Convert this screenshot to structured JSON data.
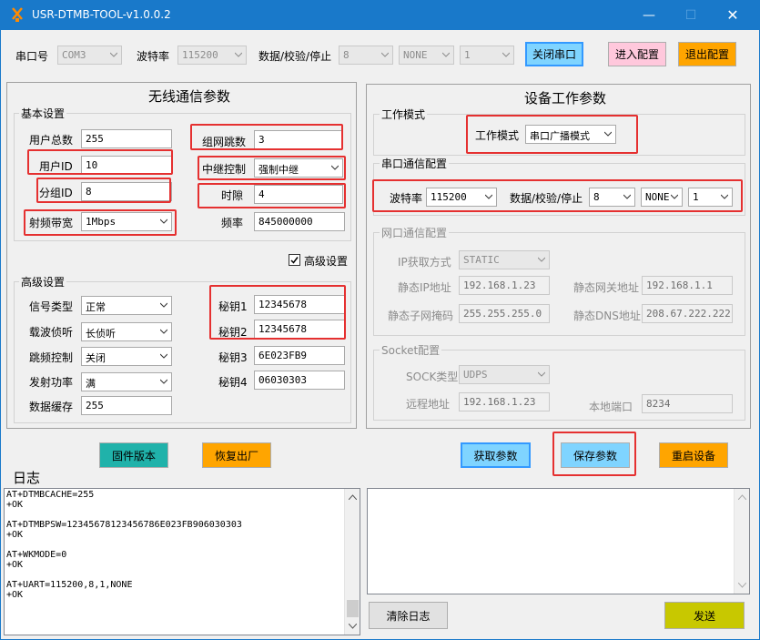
{
  "window": {
    "title": "USR-DTMB-TOOL-v1.0.0.2",
    "minimize_icon": "minimize-icon",
    "maximize_icon": "maximize-icon",
    "close_icon": "close-icon"
  },
  "top": {
    "port_label": "串口号",
    "port_value": "COM3",
    "baud_label": "波特率",
    "baud_value": "115200",
    "dps_label": "数据/校验/停止",
    "data_bits": "8",
    "parity": "NONE",
    "stop_bits": "1",
    "close_port_btn": "关闭串口",
    "enter_config_btn": "进入配置",
    "exit_config_btn": "退出配置"
  },
  "wireless": {
    "title": "无线通信参数",
    "basic_title": "基本设置",
    "total_users_label": "用户总数",
    "total_users": "255",
    "user_id_label": "用户ID",
    "user_id": "10",
    "group_id_label": "分组ID",
    "group_id": "8",
    "bandwidth_label": "射频带宽",
    "bandwidth": "1Mbps",
    "hops_label": "组网跳数",
    "hops": "3",
    "relay_label": "中继控制",
    "relay": "强制中继",
    "slot_label": "时隙",
    "slot": "4",
    "freq_label": "频率",
    "freq": "845000000",
    "advanced_checkbox": "高级设置",
    "adv_title": "高级设置",
    "signal_type_label": "信号类型",
    "signal_type": "正常",
    "carrier_label": "载波侦听",
    "carrier": "长侦听",
    "hop_ctrl_label": "跳频控制",
    "hop_ctrl": "关闭",
    "tx_power_label": "发射功率",
    "tx_power": "满",
    "cache_label": "数据缓存",
    "cache": "255",
    "key1_label": "秘钥1",
    "key1": "12345678",
    "key2_label": "秘钥2",
    "key2": "12345678",
    "key3_label": "秘钥3",
    "key3": "6E023FB9",
    "key4_label": "秘钥4",
    "key4": "06030303"
  },
  "device": {
    "title": "设备工作参数",
    "work_mode_group": "工作模式",
    "work_mode_label": "工作模式",
    "work_mode": "串口广播模式",
    "serial_group": "串口通信配置",
    "baud_label": "波特率",
    "baud": "115200",
    "dps_label": "数据/校验/停止",
    "data_bits": "8",
    "parity": "NONE",
    "stop_bits": "1",
    "net_group": "网口通信配置",
    "ip_mode_label": "IP获取方式",
    "ip_mode": "STATIC",
    "static_ip_label": "静态IP地址",
    "static_ip": "192.168.1.23",
    "gateway_label": "静态网关地址",
    "gateway": "192.168.1.1",
    "mask_label": "静态子网掩码",
    "mask": "255.255.255.0",
    "dns_label": "静态DNS地址",
    "dns": "208.67.222.222",
    "socket_group": "Socket配置",
    "sock_type_label": "SOCK类型",
    "sock_type": "UDPS",
    "remote_label": "远程地址",
    "remote": "192.168.1.23",
    "local_port_label": "本地端口",
    "local_port": "8234"
  },
  "buttons": {
    "firmware": "固件版本",
    "factory": "恢复出厂",
    "get_params": "获取参数",
    "save_params": "保存参数",
    "restart": "重启设备",
    "clear_log": "清除日志",
    "send": "发送"
  },
  "log": {
    "title": "日志",
    "lines": [
      "AT+DTMBCACHE=255",
      "+OK",
      "",
      "AT+DTMBPSW=12345678123456786E023FB906030303",
      "+OK",
      "",
      "AT+WKMODE=0",
      "+OK",
      "",
      "AT+UART=115200,8,1,NONE",
      "+OK"
    ]
  },
  "colors": {
    "titlebar": "#1979ca",
    "highlight": "#e53030",
    "btn_blue": "#7fd4ff",
    "btn_pink": "#ffc8dc",
    "btn_orange": "#ffa500",
    "btn_teal": "#20b2aa",
    "btn_olive": "#c8c800"
  }
}
